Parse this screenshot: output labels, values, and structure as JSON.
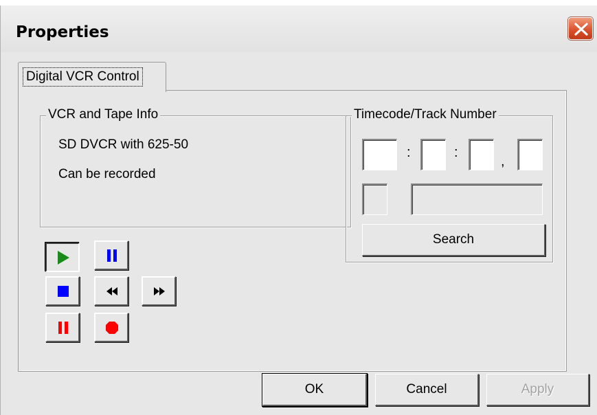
{
  "window": {
    "title": "Properties",
    "close_icon": "close-x-icon"
  },
  "tabs": [
    {
      "label": "Digital VCR Control",
      "active": true
    }
  ],
  "vcr_info": {
    "group_title": "VCR and Tape Info",
    "line1": "SD DVCR with 625-50",
    "line2": "Can be recorded"
  },
  "transport_buttons": [
    {
      "name": "play",
      "icon": "play-icon",
      "color": "#1a8a1a",
      "state": "pressed"
    },
    {
      "name": "pause",
      "icon": "pause-icon",
      "color": "#0000ff"
    },
    {
      "name": "stop",
      "icon": "stop-icon",
      "color": "#0000ff"
    },
    {
      "name": "rewind",
      "icon": "rewind-icon",
      "color": "#000000"
    },
    {
      "name": "fast-forward",
      "icon": "fast-forward-icon",
      "color": "#000000"
    },
    {
      "name": "record-pause",
      "icon": "record-pause-icon",
      "color": "#ff0000"
    },
    {
      "name": "record",
      "icon": "record-icon",
      "color": "#ff0000"
    }
  ],
  "timecode": {
    "group_title": "Timecode/Track Number",
    "hours": "",
    "minutes": "",
    "seconds": "",
    "frames": "",
    "sep1": ":",
    "sep2": ":",
    "sep3": ",",
    "track_flag": "",
    "track_number": "",
    "search_label": "Search"
  },
  "footer": {
    "ok_label": "OK",
    "cancel_label": "Cancel",
    "apply_label": "Apply"
  }
}
